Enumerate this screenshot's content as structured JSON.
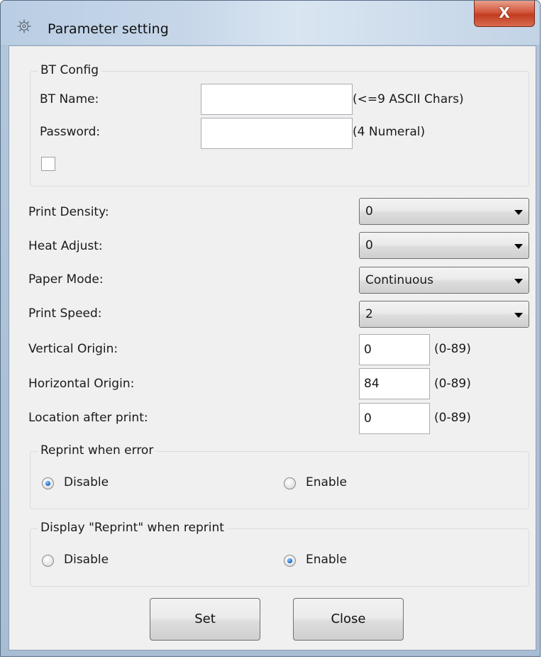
{
  "window": {
    "title": "Parameter setting",
    "close_glyph": "X",
    "title_icon": "gear-icon"
  },
  "bt_config": {
    "legend": "BT Config",
    "name_label": "BT Name:",
    "name_value": "",
    "name_hint": "(<=9 ASCII Chars)",
    "password_label": "Password:",
    "password_value": "",
    "password_hint": "(4 Numeral)",
    "checkbox_checked": false
  },
  "settings": {
    "print_density": {
      "label": "Print Density:",
      "value": "0"
    },
    "heat_adjust": {
      "label": "Heat Adjust:",
      "value": "0"
    },
    "paper_mode": {
      "label": "Paper Mode:",
      "value": "Continuous"
    },
    "print_speed": {
      "label": "Print Speed:",
      "value": "2"
    },
    "vertical_origin": {
      "label": "Vertical Origin:",
      "value": "0",
      "range": "(0-89)"
    },
    "horizontal_origin": {
      "label": "Horizontal Origin:",
      "value": "84",
      "range": "(0-89)"
    },
    "location_after_print": {
      "label": "Location after print:",
      "value": "0",
      "range": "(0-89)"
    }
  },
  "reprint_error": {
    "legend": "Reprint when error",
    "disable_label": "Disable",
    "enable_label": "Enable",
    "selected": "disable"
  },
  "display_reprint": {
    "legend": "Display \"Reprint\" when reprint",
    "disable_label": "Disable",
    "enable_label": "Enable",
    "selected": "enable"
  },
  "buttons": {
    "set_label": "Set",
    "close_label": "Close"
  },
  "colors": {
    "accent": "#1c6fc8",
    "close_button": "#c13d22"
  }
}
